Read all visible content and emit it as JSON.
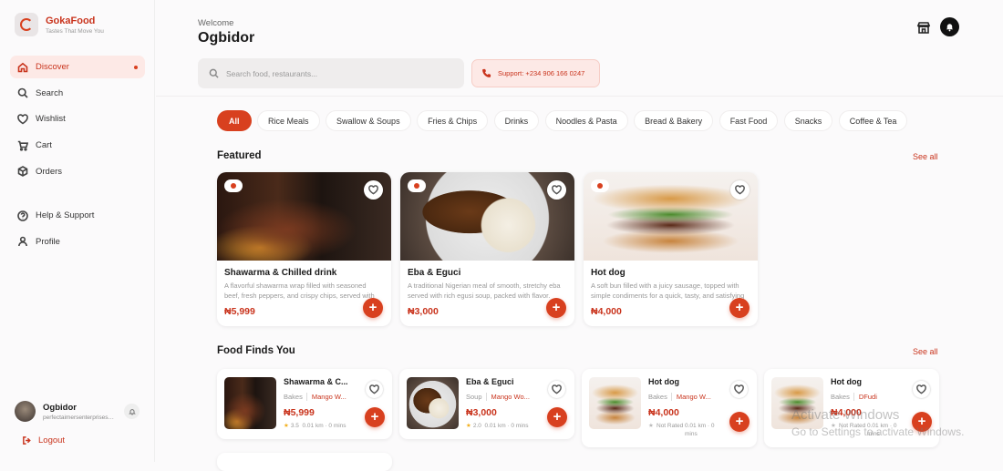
{
  "brand": {
    "name": "GokaFood",
    "tagline": "Tastes That Move You"
  },
  "nav": [
    {
      "label": "Discover",
      "icon": "home-icon",
      "active": true
    },
    {
      "label": "Search",
      "icon": "search-icon"
    },
    {
      "label": "Wishlist",
      "icon": "heart-icon"
    },
    {
      "label": "Cart",
      "icon": "cart-icon"
    },
    {
      "label": "Orders",
      "icon": "box-icon"
    }
  ],
  "nav_secondary": [
    {
      "label": "Help & Support",
      "icon": "help-icon"
    },
    {
      "label": "Profile",
      "icon": "user-icon"
    }
  ],
  "user": {
    "name": "Ogbidor",
    "email": "perfectaimersenterprises@gmail.com"
  },
  "logout_label": "Logout",
  "header": {
    "welcome": "Welcome",
    "name": "Ogbidor",
    "search_placeholder": "Search food, restaurants...",
    "support": "Support: +234 906 166 0247"
  },
  "categories": [
    "All",
    "Rice Meals",
    "Swallow & Soups",
    "Fries & Chips",
    "Drinks",
    "Noodles & Pasta",
    "Bread & Bakery",
    "Fast Food",
    "Snacks",
    "Coffee & Tea"
  ],
  "featured": {
    "title": "Featured",
    "see_all": "See all",
    "items": [
      {
        "title": "Shawarma & Chilled drink",
        "desc": "A flavorful shawarma wrap filled with seasoned beef, fresh peppers, and crispy chips, served with a chilled drink.",
        "price": "₦5,999"
      },
      {
        "title": "Eba & Eguci",
        "desc": "A traditional Nigerian meal of smooth, stretchy eba served with rich egusi soup, packed with flavor.",
        "price": "₦3,000"
      },
      {
        "title": "Hot dog",
        "desc": "A soft bun filled with a juicy sausage, topped with simple condiments for a quick, tasty, and satisfying bite.",
        "price": "₦4,000"
      }
    ]
  },
  "finds": {
    "title": "Food Finds You",
    "see_all": "See all",
    "items": [
      {
        "title": "Shawarma & C...",
        "category": "Bakes",
        "store": "Mango W...",
        "price": "₦5,999",
        "rating": "3.5",
        "distance": "0.01 km · 0 mins"
      },
      {
        "title": "Eba & Eguci",
        "category": "Soup",
        "store": "Mango Wo...",
        "price": "₦3,000",
        "rating": "2.0",
        "distance": "0.01 km · 0 mins"
      },
      {
        "title": "Hot dog",
        "category": "Bakes",
        "store": "Mango W...",
        "price": "₦4,000",
        "rating": "Not Rated",
        "distance": "0.01 km · 0 mins"
      },
      {
        "title": "Hot dog",
        "category": "Bakes",
        "store": "DFudi",
        "price": "₦4,000",
        "rating": "Not Rated",
        "distance": "0.01 km · 0 mins"
      }
    ]
  },
  "watermark": {
    "line1": "Activate Windows",
    "line2": "Go to Settings to activate Windows."
  },
  "colors": {
    "accent": "#d8401f",
    "brand_text": "#c9341d",
    "active_bg": "#fde9e6"
  }
}
